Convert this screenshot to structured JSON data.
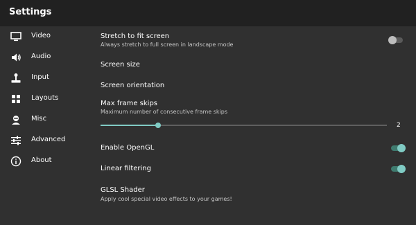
{
  "appbar": {
    "title": "Settings"
  },
  "sidebar": {
    "items": [
      {
        "label": "Video",
        "icon": "monitor-icon"
      },
      {
        "label": "Audio",
        "icon": "speaker-icon"
      },
      {
        "label": "Input",
        "icon": "joystick-icon"
      },
      {
        "label": "Layouts",
        "icon": "grid-icon"
      },
      {
        "label": "Misc",
        "icon": "person-icon"
      },
      {
        "label": "Advanced",
        "icon": "tune-icon"
      },
      {
        "label": "About",
        "icon": "info-icon"
      }
    ]
  },
  "video": {
    "stretch": {
      "title": "Stretch to fit screen",
      "summary": "Always stretch to full screen in landscape mode",
      "enabled": false
    },
    "screen_size": {
      "title": "Screen size"
    },
    "screen_orientation": {
      "title": "Screen orientation"
    },
    "frame_skips": {
      "title": "Max frame skips",
      "summary": "Maximum number of consecutive frame skips",
      "value": "2",
      "level": 0.2
    },
    "opengl": {
      "title": "Enable OpenGL",
      "enabled": true
    },
    "linear_filtering": {
      "title": "Linear filtering",
      "enabled": true
    },
    "glsl_shader": {
      "title": "GLSL Shader",
      "summary": "Apply cool special video effects to your games!"
    }
  },
  "colors": {
    "accent": "#80cbc4",
    "appbar": "#212121",
    "background": "#303030"
  }
}
